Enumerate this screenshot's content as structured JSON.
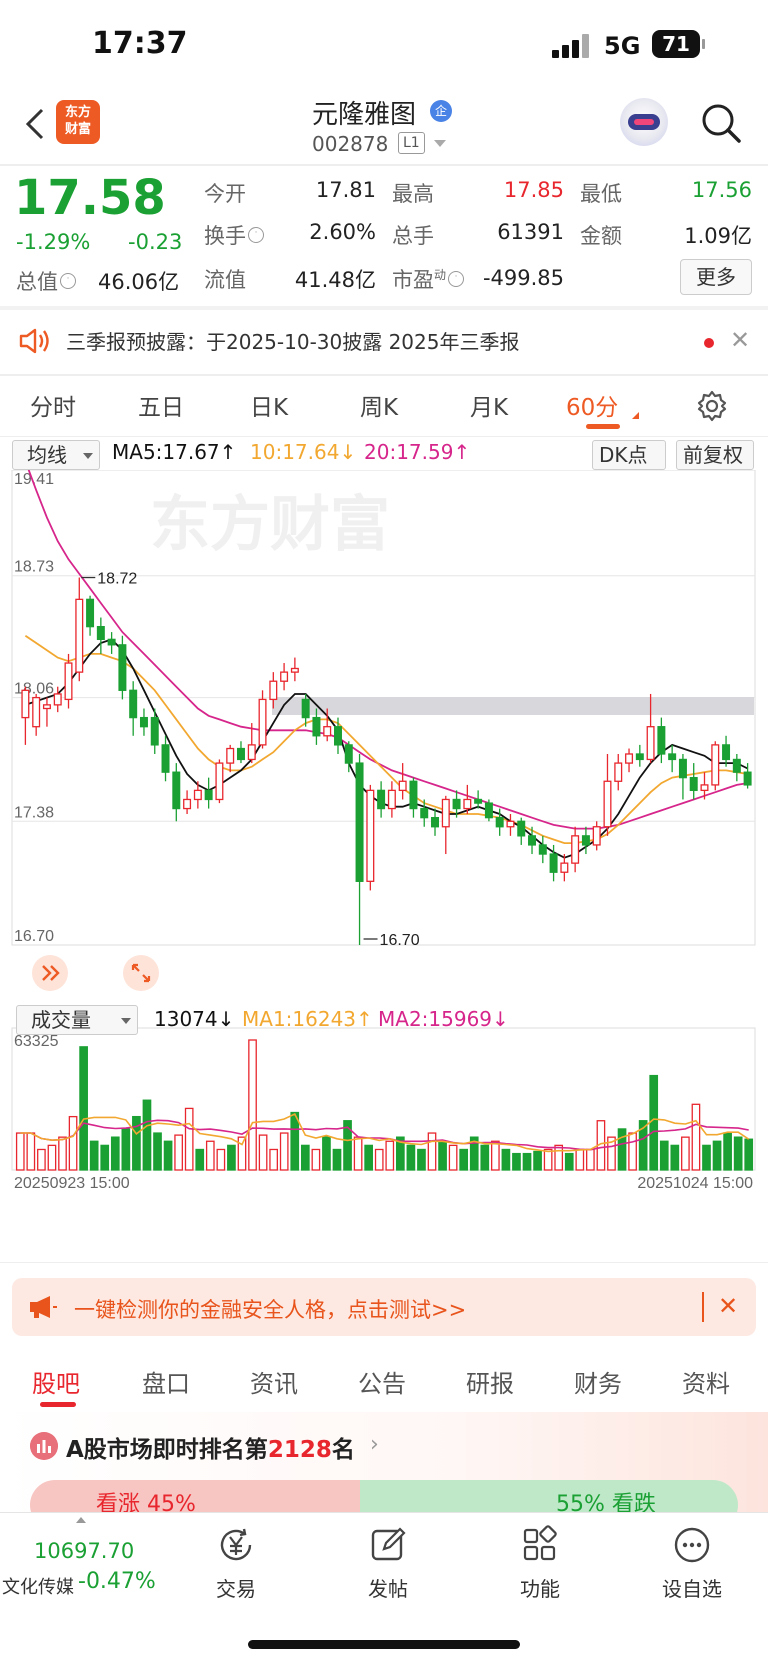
{
  "status_bar": {
    "time": "17:37",
    "network": "5G",
    "battery": "71"
  },
  "header": {
    "logo_line1": "东方",
    "logo_line2": "财富",
    "stock_name": "元隆雅图",
    "badge": "企",
    "code": "002878",
    "level": "L1"
  },
  "quote": {
    "price": "17.58",
    "change_pct": "-1.29%",
    "change": "-0.23",
    "total_cap_label": "总值",
    "total_cap": "46.06亿",
    "fields": [
      {
        "label": "今开",
        "value": "17.81",
        "color": "#222222"
      },
      {
        "label": "最高",
        "value": "17.85",
        "color": "#e8262d"
      },
      {
        "label": "最低",
        "value": "17.56",
        "color": "#1aa033"
      },
      {
        "label": "换手",
        "value": "2.60%",
        "color": "#222222"
      },
      {
        "label": "总手",
        "value": "61391",
        "color": "#222222"
      },
      {
        "label": "金额",
        "value": "1.09亿",
        "color": "#222222"
      },
      {
        "label": "流值",
        "value": "41.48亿",
        "color": "#222222"
      },
      {
        "label": "市盈",
        "value": "-499.85",
        "color": "#222222"
      }
    ],
    "pe_sup": "动",
    "more_button": "更多"
  },
  "notice": {
    "text": "三季报预披露：于2025-10-30披露 2025年三季报"
  },
  "period_tabs": [
    "分时",
    "五日",
    "日K",
    "周K",
    "月K",
    "60分"
  ],
  "active_period": "60分",
  "ma_bar": {
    "select": "均线",
    "ma5": "MA5:17.67",
    "ma5_arrow": "↑",
    "ma10": "10:17.64",
    "ma10_arrow": "↓",
    "ma20": "20:17.59",
    "ma20_arrow": "↑",
    "dk_button": "DK点",
    "adjust_button": "前复权"
  },
  "vol_bar": {
    "select": "成交量",
    "vol": "13074",
    "vol_arrow": "↓",
    "ma1": "MA1:16243",
    "ma1_arrow": "↑",
    "ma2": "MA2:15969",
    "ma2_arrow": "↓"
  },
  "chart_data": {
    "type": "candlestick",
    "y_ticks": [
      "19.41",
      "18.73",
      "18.06",
      "17.38",
      "16.70"
    ],
    "ylim": [
      16.7,
      19.41
    ],
    "max_label": "18.72",
    "min_label": "16.70",
    "colors": {
      "up": "#e8262d",
      "down": "#1aa033",
      "ma5": "#111111",
      "ma10": "#f2a830",
      "ma20": "#d6258b"
    },
    "candles": [
      [
        17.95,
        18.1,
        17.8,
        18.12
      ],
      [
        17.9,
        18.06,
        17.85,
        18.08
      ],
      [
        18.0,
        18.02,
        17.9,
        18.06
      ],
      [
        18.02,
        18.08,
        17.98,
        18.12
      ],
      [
        18.05,
        18.25,
        18.0,
        18.3
      ],
      [
        18.2,
        18.6,
        18.15,
        18.72
      ],
      [
        18.6,
        18.45,
        18.4,
        18.62
      ],
      [
        18.45,
        18.38,
        18.3,
        18.5
      ],
      [
        18.38,
        18.35,
        18.3,
        18.42
      ],
      [
        18.35,
        18.1,
        18.05,
        18.4
      ],
      [
        18.1,
        17.95,
        17.85,
        18.15
      ],
      [
        17.95,
        17.9,
        17.85,
        18.0
      ],
      [
        17.95,
        17.8,
        17.75,
        18.0
      ],
      [
        17.8,
        17.65,
        17.6,
        17.85
      ],
      [
        17.65,
        17.45,
        17.38,
        17.7
      ],
      [
        17.45,
        17.5,
        17.42,
        17.55
      ],
      [
        17.5,
        17.55,
        17.45,
        17.6
      ],
      [
        17.55,
        17.5,
        17.45,
        17.62
      ],
      [
        17.5,
        17.7,
        17.48,
        17.72
      ],
      [
        17.7,
        17.78,
        17.65,
        17.8
      ],
      [
        17.78,
        17.72,
        17.7,
        17.82
      ],
      [
        17.72,
        17.8,
        17.7,
        17.92
      ],
      [
        17.8,
        18.05,
        17.78,
        18.1
      ],
      [
        18.05,
        18.15,
        18.0,
        18.2
      ],
      [
        18.15,
        18.2,
        18.1,
        18.25
      ],
      [
        18.2,
        18.22,
        18.15,
        18.28
      ],
      [
        18.05,
        17.95,
        17.9,
        18.08
      ],
      [
        17.95,
        17.85,
        17.8,
        18.0
      ],
      [
        17.85,
        17.9,
        17.82,
        18.0
      ],
      [
        17.9,
        17.8,
        17.75,
        17.95
      ],
      [
        17.8,
        17.7,
        17.65,
        17.82
      ],
      [
        17.7,
        17.05,
        16.7,
        17.75
      ],
      [
        17.05,
        17.55,
        17.0,
        17.58
      ],
      [
        17.55,
        17.45,
        17.4,
        17.6
      ],
      [
        17.45,
        17.55,
        17.4,
        17.6
      ],
      [
        17.55,
        17.6,
        17.5,
        17.7
      ],
      [
        17.6,
        17.45,
        17.4,
        17.62
      ],
      [
        17.45,
        17.4,
        17.35,
        17.5
      ],
      [
        17.4,
        17.35,
        17.3,
        17.45
      ],
      [
        17.35,
        17.5,
        17.2,
        17.52
      ],
      [
        17.5,
        17.45,
        17.4,
        17.55
      ],
      [
        17.45,
        17.5,
        17.42,
        17.58
      ],
      [
        17.5,
        17.48,
        17.45,
        17.55
      ],
      [
        17.48,
        17.4,
        17.38,
        17.5
      ],
      [
        17.4,
        17.35,
        17.3,
        17.45
      ],
      [
        17.35,
        17.38,
        17.3,
        17.42
      ],
      [
        17.38,
        17.3,
        17.25,
        17.4
      ],
      [
        17.3,
        17.25,
        17.2,
        17.35
      ],
      [
        17.25,
        17.2,
        17.15,
        17.3
      ],
      [
        17.2,
        17.1,
        17.05,
        17.25
      ],
      [
        17.1,
        17.15,
        17.05,
        17.2
      ],
      [
        17.15,
        17.3,
        17.1,
        17.35
      ],
      [
        17.3,
        17.25,
        17.2,
        17.35
      ],
      [
        17.25,
        17.35,
        17.22,
        17.38
      ],
      [
        17.35,
        17.6,
        17.3,
        17.75
      ],
      [
        17.6,
        17.7,
        17.55,
        17.75
      ],
      [
        17.7,
        17.75,
        17.65,
        17.78
      ],
      [
        17.75,
        17.72,
        17.68,
        17.8
      ],
      [
        17.72,
        17.9,
        17.7,
        18.08
      ],
      [
        17.9,
        17.75,
        17.7,
        17.95
      ],
      [
        17.75,
        17.72,
        17.65,
        17.8
      ],
      [
        17.72,
        17.62,
        17.5,
        17.75
      ],
      [
        17.62,
        17.55,
        17.5,
        17.7
      ],
      [
        17.55,
        17.58,
        17.5,
        17.65
      ],
      [
        17.58,
        17.8,
        17.55,
        17.82
      ],
      [
        17.8,
        17.72,
        17.68,
        17.85
      ],
      [
        17.72,
        17.65,
        17.6,
        17.75
      ],
      [
        17.65,
        17.58,
        17.56,
        17.7
      ]
    ],
    "ma5": [
      18.02,
      18.04,
      18.06,
      18.08,
      18.14,
      18.22,
      18.3,
      18.36,
      18.38,
      18.32,
      18.22,
      18.1,
      17.98,
      17.86,
      17.74,
      17.64,
      17.58,
      17.55,
      17.58,
      17.62,
      17.66,
      17.72,
      17.82,
      17.92,
      18.02,
      18.08,
      18.08,
      18.02,
      17.96,
      17.88,
      17.7,
      17.58,
      17.52,
      17.48,
      17.46,
      17.46,
      17.48,
      17.46,
      17.44,
      17.42,
      17.42,
      17.44,
      17.46,
      17.44,
      17.42,
      17.38,
      17.35,
      17.3,
      17.25,
      17.21,
      17.18,
      17.2,
      17.24,
      17.28,
      17.34,
      17.42,
      17.52,
      17.62,
      17.7,
      17.76,
      17.8,
      17.78,
      17.76,
      17.74,
      17.7,
      17.7,
      17.7,
      17.67
    ],
    "ma10": [
      18.4,
      18.36,
      18.32,
      18.28,
      18.26,
      18.28,
      18.3,
      18.3,
      18.28,
      18.26,
      18.22,
      18.16,
      18.1,
      18.02,
      17.94,
      17.86,
      17.78,
      17.72,
      17.68,
      17.66,
      17.66,
      17.68,
      17.72,
      17.76,
      17.82,
      17.88,
      17.92,
      17.94,
      17.94,
      17.92,
      17.86,
      17.8,
      17.74,
      17.68,
      17.62,
      17.56,
      17.52,
      17.48,
      17.46,
      17.44,
      17.42,
      17.42,
      17.42,
      17.41,
      17.4,
      17.38,
      17.36,
      17.33,
      17.3,
      17.28,
      17.26,
      17.26,
      17.27,
      17.28,
      17.31,
      17.36,
      17.42,
      17.48,
      17.54,
      17.59,
      17.62,
      17.63,
      17.64,
      17.65,
      17.66,
      17.66,
      17.65,
      17.64
    ],
    "ma20": [
      19.36,
      19.2,
      19.05,
      18.92,
      18.82,
      18.74,
      18.66,
      18.58,
      18.5,
      18.42,
      18.36,
      18.3,
      18.24,
      18.18,
      18.12,
      18.06,
      18.0,
      17.96,
      17.94,
      17.92,
      17.9,
      17.89,
      17.88,
      17.88,
      17.88,
      17.88,
      17.88,
      17.87,
      17.86,
      17.84,
      17.8,
      17.76,
      17.72,
      17.69,
      17.66,
      17.64,
      17.62,
      17.6,
      17.58,
      17.56,
      17.54,
      17.52,
      17.5,
      17.48,
      17.46,
      17.44,
      17.42,
      17.4,
      17.38,
      17.36,
      17.35,
      17.34,
      17.34,
      17.34,
      17.35,
      17.36,
      17.38,
      17.4,
      17.42,
      17.44,
      17.46,
      17.48,
      17.5,
      17.52,
      17.54,
      17.56,
      17.58,
      17.59
    ],
    "volume": {
      "max_label": "63325",
      "ymax": 63325,
      "start_label": "20250923 15:00",
      "end_label": "20251024 15:00",
      "values": [
        18000,
        18000,
        10000,
        12000,
        16000,
        26000,
        60000,
        14000,
        12000,
        16000,
        20000,
        26000,
        34000,
        18000,
        14000,
        17000,
        30000,
        10000,
        14000,
        10000,
        12000,
        16000,
        63325,
        17000,
        10000,
        18000,
        28000,
        12000,
        10000,
        16000,
        10000,
        24000,
        16000,
        12000,
        10000,
        14000,
        16000,
        12000,
        10000,
        18000,
        14000,
        12000,
        10000,
        16000,
        12000,
        14000,
        10000,
        8000,
        8000,
        9000,
        10000,
        12000,
        8000,
        10000,
        10000,
        24000,
        16000,
        20000,
        18000,
        24000,
        46000,
        14000,
        12000,
        16000,
        32000,
        12000,
        14000,
        18000,
        16000,
        15000
      ]
    }
  },
  "ad": {
    "text": "一键检测你的金融安全人格，点击测试>>"
  },
  "news_tabs": [
    "股吧",
    "盘口",
    "资讯",
    "公告",
    "研报",
    "财务",
    "资料"
  ],
  "active_news_tab": "股吧",
  "rank": {
    "prefix": "A股市场即时排名第",
    "number": "2128",
    "suffix": "名",
    "rise": "看涨 45%",
    "fall": "55% 看跌"
  },
  "bottom_bar": {
    "index_value": "10697.70",
    "index_label": "文化传媒",
    "index_pct": "-0.47%",
    "items": [
      {
        "label": "交易",
        "icon": "trade-yen-icon"
      },
      {
        "label": "发帖",
        "icon": "post-edit-icon"
      },
      {
        "label": "功能",
        "icon": "function-grid-icon"
      },
      {
        "label": "设自选",
        "icon": "more-dots-icon"
      }
    ]
  }
}
